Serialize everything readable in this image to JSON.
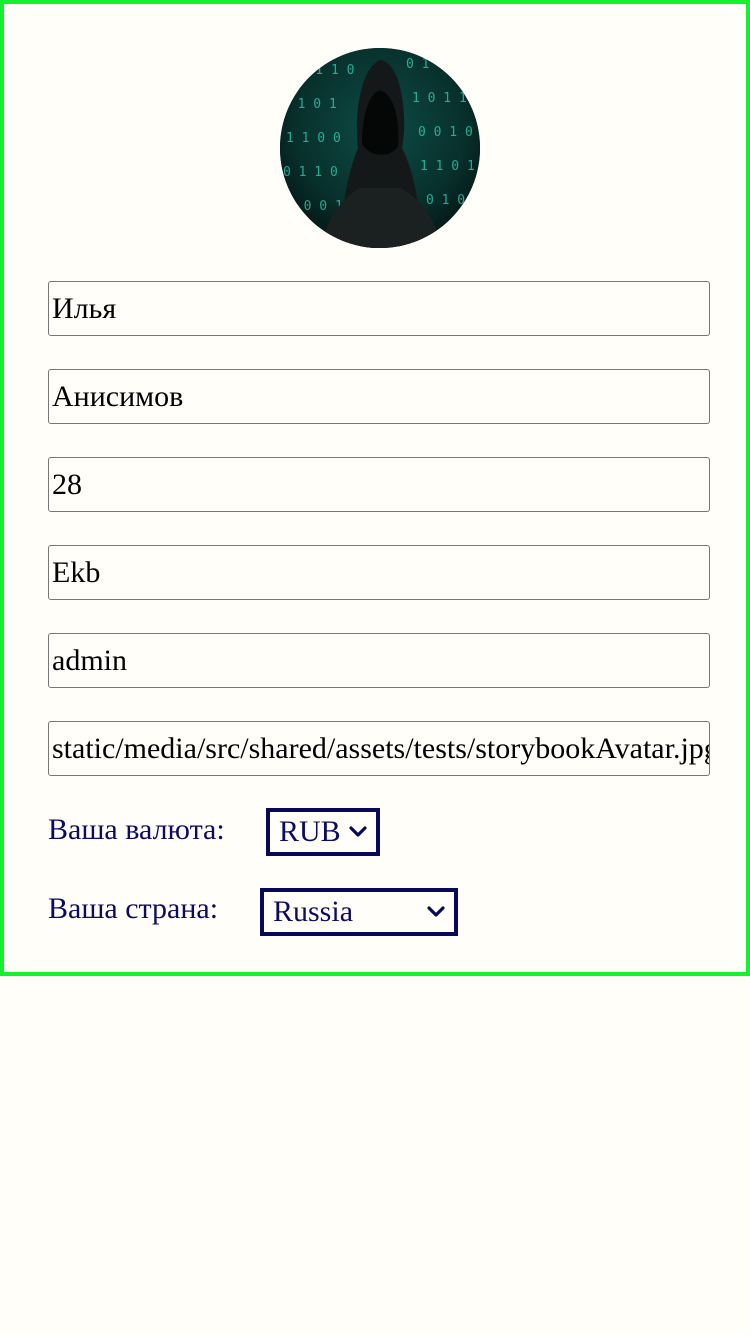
{
  "profile": {
    "avatar_alt": "",
    "first_name": "Илья",
    "last_name": "Анисимов",
    "age": "28",
    "city": "Ekb",
    "username": "admin",
    "avatar_url": "static/media/src/shared/assets/tests/storybookAvatar.jpg"
  },
  "currency": {
    "label": "Ваша валюта:",
    "selected": "RUB",
    "icon": "chevron-down-icon"
  },
  "country": {
    "label": "Ваша страна:",
    "selected": "Russia",
    "icon": "chevron-down-icon"
  },
  "colors": {
    "card_border": "#12f22d",
    "accent": "#07075c",
    "label_text": "#0b0b63",
    "background": "#fffef8"
  }
}
